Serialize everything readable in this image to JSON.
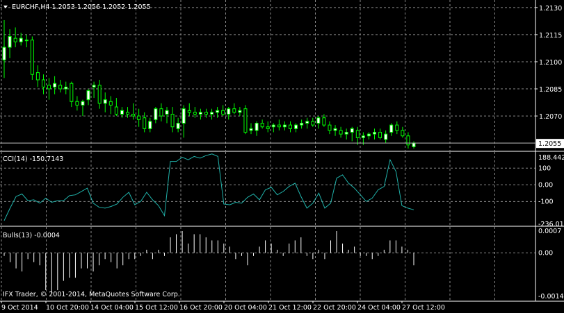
{
  "window": {
    "menu_icon": "triangle-down-icon",
    "title": "EURCHF,H4  1.2053 1.2056 1.2052 1.2055",
    "copyright": "IFX Trader, © 2001-2014, MetaQuotes Software Corp."
  },
  "colors": {
    "background": "#000000",
    "grid": "#8a8a8a",
    "candle_bull": "#ffffff",
    "candle_bear": "#000000",
    "candle_outline": "#00ff00",
    "cci_line": "#20b2aa",
    "bulls_bar": "#ffffff",
    "text": "#ffffff"
  },
  "chart_data": [
    {
      "type": "candlestick",
      "title": "EURCHF,H4  1.2053 1.2056 1.2052 1.2055",
      "yaxis": {
        "ylim": [
          1.2052,
          1.2133
        ],
        "tick_labels": [
          "1.2130",
          "1.2115",
          "1.2100",
          "1.2085",
          "1.2070",
          "1.2055"
        ]
      },
      "current_price_label": "1.2055",
      "current_price": 1.2055,
      "grid": true,
      "candles": [
        {
          "o": 1.2101,
          "h": 1.2123,
          "l": 1.2091,
          "c": 1.2108
        },
        {
          "o": 1.2108,
          "h": 1.2118,
          "l": 1.2102,
          "c": 1.2114
        },
        {
          "o": 1.2113,
          "h": 1.2119,
          "l": 1.2108,
          "c": 1.2111
        },
        {
          "o": 1.2111,
          "h": 1.2116,
          "l": 1.2109,
          "c": 1.2113
        },
        {
          "o": 1.2112,
          "h": 1.2115,
          "l": 1.2108,
          "c": 1.2112
        },
        {
          "o": 1.2112,
          "h": 1.2114,
          "l": 1.209,
          "c": 1.2093
        },
        {
          "o": 1.2094,
          "h": 1.2098,
          "l": 1.2086,
          "c": 1.209
        },
        {
          "o": 1.209,
          "h": 1.2093,
          "l": 1.2082,
          "c": 1.2086
        },
        {
          "o": 1.2087,
          "h": 1.2091,
          "l": 1.2079,
          "c": 1.2085
        },
        {
          "o": 1.2086,
          "h": 1.2092,
          "l": 1.2082,
          "c": 1.2088
        },
        {
          "o": 1.2087,
          "h": 1.209,
          "l": 1.2083,
          "c": 1.2085
        },
        {
          "o": 1.2085,
          "h": 1.2089,
          "l": 1.2082,
          "c": 1.2086
        },
        {
          "o": 1.2088,
          "h": 1.2089,
          "l": 1.2075,
          "c": 1.2078
        },
        {
          "o": 1.2078,
          "h": 1.2081,
          "l": 1.2073,
          "c": 1.2076
        },
        {
          "o": 1.2076,
          "h": 1.2079,
          "l": 1.207,
          "c": 1.2078
        },
        {
          "o": 1.2079,
          "h": 1.2085,
          "l": 1.2076,
          "c": 1.2084
        },
        {
          "o": 1.2086,
          "h": 1.2089,
          "l": 1.208,
          "c": 1.2087
        },
        {
          "o": 1.2087,
          "h": 1.209,
          "l": 1.2074,
          "c": 1.2077
        },
        {
          "o": 1.2077,
          "h": 1.2083,
          "l": 1.2072,
          "c": 1.2079
        },
        {
          "o": 1.2078,
          "h": 1.2081,
          "l": 1.2071,
          "c": 1.2076
        },
        {
          "o": 1.2075,
          "h": 1.208,
          "l": 1.207,
          "c": 1.2071
        },
        {
          "o": 1.2071,
          "h": 1.2075,
          "l": 1.2069,
          "c": 1.2073
        },
        {
          "o": 1.2072,
          "h": 1.2075,
          "l": 1.2069,
          "c": 1.2071
        },
        {
          "o": 1.2071,
          "h": 1.2077,
          "l": 1.2068,
          "c": 1.207
        },
        {
          "o": 1.207,
          "h": 1.2074,
          "l": 1.2064,
          "c": 1.2068
        },
        {
          "o": 1.2069,
          "h": 1.2072,
          "l": 1.2061,
          "c": 1.2063
        },
        {
          "o": 1.2063,
          "h": 1.2069,
          "l": 1.2061,
          "c": 1.2067
        },
        {
          "o": 1.2068,
          "h": 1.2075,
          "l": 1.2066,
          "c": 1.2074
        },
        {
          "o": 1.2074,
          "h": 1.2077,
          "l": 1.2067,
          "c": 1.207
        },
        {
          "o": 1.2071,
          "h": 1.2075,
          "l": 1.2066,
          "c": 1.2073
        },
        {
          "o": 1.2071,
          "h": 1.2075,
          "l": 1.2061,
          "c": 1.2064
        },
        {
          "o": 1.2063,
          "h": 1.2069,
          "l": 1.2061,
          "c": 1.2066
        },
        {
          "o": 1.2066,
          "h": 1.2076,
          "l": 1.2058,
          "c": 1.2074
        },
        {
          "o": 1.2073,
          "h": 1.2077,
          "l": 1.207,
          "c": 1.2072
        },
        {
          "o": 1.2072,
          "h": 1.2075,
          "l": 1.2069,
          "c": 1.2071
        },
        {
          "o": 1.2071,
          "h": 1.2074,
          "l": 1.2068,
          "c": 1.2072
        },
        {
          "o": 1.2072,
          "h": 1.2074,
          "l": 1.2069,
          "c": 1.2071
        },
        {
          "o": 1.2071,
          "h": 1.2074,
          "l": 1.2068,
          "c": 1.2072
        },
        {
          "o": 1.2072,
          "h": 1.2075,
          "l": 1.2069,
          "c": 1.2073
        },
        {
          "o": 1.2073,
          "h": 1.2076,
          "l": 1.207,
          "c": 1.2071
        },
        {
          "o": 1.2071,
          "h": 1.2075,
          "l": 1.2068,
          "c": 1.2074
        },
        {
          "o": 1.2074,
          "h": 1.2077,
          "l": 1.2071,
          "c": 1.2072
        },
        {
          "o": 1.2072,
          "h": 1.2075,
          "l": 1.207,
          "c": 1.2073
        },
        {
          "o": 1.2074,
          "h": 1.2076,
          "l": 1.206,
          "c": 1.2061
        },
        {
          "o": 1.2062,
          "h": 1.2066,
          "l": 1.206,
          "c": 1.2063
        },
        {
          "o": 1.2062,
          "h": 1.2067,
          "l": 1.2059,
          "c": 1.2066
        },
        {
          "o": 1.2066,
          "h": 1.2068,
          "l": 1.2063,
          "c": 1.2064
        },
        {
          "o": 1.2064,
          "h": 1.2067,
          "l": 1.2061,
          "c": 1.2063
        },
        {
          "o": 1.2064,
          "h": 1.2066,
          "l": 1.2061,
          "c": 1.2065
        },
        {
          "o": 1.2065,
          "h": 1.2068,
          "l": 1.2062,
          "c": 1.2064
        },
        {
          "o": 1.2064,
          "h": 1.2067,
          "l": 1.2062,
          "c": 1.2065
        },
        {
          "o": 1.2065,
          "h": 1.2067,
          "l": 1.2061,
          "c": 1.2063
        },
        {
          "o": 1.2063,
          "h": 1.2066,
          "l": 1.2061,
          "c": 1.2065
        },
        {
          "o": 1.2065,
          "h": 1.2068,
          "l": 1.2063,
          "c": 1.2066
        },
        {
          "o": 1.2066,
          "h": 1.2069,
          "l": 1.2063,
          "c": 1.2067
        },
        {
          "o": 1.2067,
          "h": 1.2069,
          "l": 1.2064,
          "c": 1.2065
        },
        {
          "o": 1.2066,
          "h": 1.207,
          "l": 1.2063,
          "c": 1.2069
        },
        {
          "o": 1.2069,
          "h": 1.2071,
          "l": 1.2064,
          "c": 1.2065
        },
        {
          "o": 1.2065,
          "h": 1.2067,
          "l": 1.206,
          "c": 1.2062
        },
        {
          "o": 1.2062,
          "h": 1.2065,
          "l": 1.2059,
          "c": 1.2063
        },
        {
          "o": 1.2062,
          "h": 1.2064,
          "l": 1.2058,
          "c": 1.206
        },
        {
          "o": 1.206,
          "h": 1.2063,
          "l": 1.2057,
          "c": 1.2061
        },
        {
          "o": 1.2061,
          "h": 1.2064,
          "l": 1.2056,
          "c": 1.2063
        },
        {
          "o": 1.2062,
          "h": 1.2064,
          "l": 1.2054,
          "c": 1.2058
        },
        {
          "o": 1.2058,
          "h": 1.2061,
          "l": 1.2054,
          "c": 1.2059
        },
        {
          "o": 1.2059,
          "h": 1.2061,
          "l": 1.2057,
          "c": 1.206
        },
        {
          "o": 1.206,
          "h": 1.2063,
          "l": 1.2057,
          "c": 1.2061
        },
        {
          "o": 1.2061,
          "h": 1.2063,
          "l": 1.2057,
          "c": 1.2058
        },
        {
          "o": 1.2057,
          "h": 1.2062,
          "l": 1.2055,
          "c": 1.206
        },
        {
          "o": 1.2061,
          "h": 1.2066,
          "l": 1.2059,
          "c": 1.2065
        },
        {
          "o": 1.2065,
          "h": 1.2067,
          "l": 1.206,
          "c": 1.2062
        },
        {
          "o": 1.2062,
          "h": 1.2064,
          "l": 1.2058,
          "c": 1.2059
        },
        {
          "o": 1.2059,
          "h": 1.2061,
          "l": 1.2052,
          "c": 1.2054
        },
        {
          "o": 1.2053,
          "h": 1.2056,
          "l": 1.2052,
          "c": 1.2055
        }
      ]
    },
    {
      "type": "line",
      "title": "CCI(14) -150.7143",
      "yaxis": {
        "ylim": [
          -236.015,
          188.4428
        ],
        "tick_labels": [
          "188.4428",
          "100",
          "0.00",
          "-100",
          "-236.015"
        ],
        "tick_values": [
          188.4428,
          100,
          0,
          -100,
          -236.015
        ]
      },
      "grid": true,
      "values": [
        -215,
        -140,
        -70,
        -55,
        -95,
        -90,
        -110,
        -80,
        -105,
        -95,
        -95,
        -65,
        -60,
        -40,
        -20,
        -110,
        -135,
        -140,
        -130,
        -115,
        -75,
        -45,
        -120,
        -100,
        -45,
        -90,
        -125,
        -185,
        140,
        140,
        165,
        150,
        170,
        160,
        175,
        185,
        170,
        -115,
        -120,
        -105,
        -110,
        -75,
        -55,
        -90,
        -30,
        -15,
        -60,
        -40,
        -10,
        10,
        -70,
        -140,
        -110,
        -50,
        -140,
        -110,
        40,
        60,
        10,
        -20,
        -60,
        -100,
        -80,
        -30,
        -10,
        150,
        80,
        -125,
        -140,
        -150
      ],
      "last_value": -150.7143
    },
    {
      "type": "bar",
      "title": "Bulls(13) -0.0004",
      "yaxis": {
        "ylim": [
          -0.0014,
          0.0007
        ],
        "tick_labels": [
          "0.0007",
          "0.00",
          "-0.0014"
        ],
        "tick_values": [
          0.0007,
          0,
          -0.0014
        ]
      },
      "grid": true,
      "values": [
        -0.0001,
        -0.0003,
        -0.0005,
        -0.0006,
        -0.0002,
        -0.0003,
        -0.0004,
        -0.0012,
        -0.0013,
        -0.0012,
        -0.0009,
        -0.0008,
        -0.0008,
        -0.0005,
        -0.0005,
        -0.0006,
        -0.0004,
        -0.0002,
        -0.0003,
        -0.0005,
        -0.0004,
        -0.0002,
        -0.0002,
        -0.0001,
        0.0001,
        -0.0002,
        0.0001,
        -0.0001,
        0.0005,
        0.0006,
        0.0007,
        0.0003,
        0.0006,
        0.0006,
        0.0005,
        0.0004,
        0.0004,
        0.0003,
        0.0002,
        -0.0002,
        -0.0001,
        -0.0004,
        -0.0001,
        0.0002,
        0.0004,
        0.0003,
        0.0001,
        -0.0001,
        0.0003,
        0.0004,
        0.0005,
        -0.0001,
        -0.0002,
        0.0001,
        -0.0002,
        0.0004,
        0.0007,
        0.0003,
        0.0001,
        0.0002,
        -0.0001,
        -0.0001,
        -0.0002,
        -0.0001,
        0.0001,
        0.0004,
        0.0004,
        0.0002,
        0.0001,
        -0.0004
      ],
      "last_value": -0.0004
    }
  ],
  "xaxis": {
    "tick_labels": [
      "9 Oct 2014",
      "10 Oct 20:00",
      "14 Oct 04:00",
      "15 Oct 12:00",
      "16 Oct 20:00",
      "20 Oct 04:00",
      "21 Oct 12:00",
      "22 Oct 20:00",
      "24 Oct 04:00",
      "27 Oct 12:00"
    ]
  }
}
